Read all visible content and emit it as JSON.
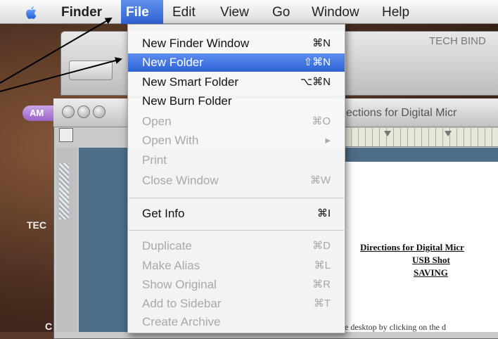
{
  "menubar": {
    "apple_icon": "apple-logo-icon",
    "items": [
      {
        "label": "Finder"
      },
      {
        "label": "File"
      },
      {
        "label": "Edit"
      },
      {
        "label": "View"
      },
      {
        "label": "Go"
      },
      {
        "label": "Window"
      },
      {
        "label": "Help"
      }
    ]
  },
  "file_menu": {
    "items": [
      {
        "label": "New Finder Window",
        "shortcut": "⌘N"
      },
      {
        "label": "New Folder",
        "shortcut": "⇧⌘N"
      },
      {
        "label": "New Smart Folder",
        "shortcut": "⌥⌘N"
      },
      {
        "label": "New Burn Folder",
        "shortcut": ""
      },
      {
        "label": "Open",
        "shortcut": "⌘O"
      },
      {
        "label": "Open With",
        "shortcut": "▸"
      },
      {
        "label": "Print",
        "shortcut": ""
      },
      {
        "label": "Close Window",
        "shortcut": "⌘W"
      },
      {
        "label": "Get Info",
        "shortcut": "⌘I"
      },
      {
        "label": "Duplicate",
        "shortcut": "⌘D"
      },
      {
        "label": "Make Alias",
        "shortcut": "⌘L"
      },
      {
        "label": "Show Original",
        "shortcut": "⌘R"
      },
      {
        "label": "Add to Sidebar",
        "shortcut": "⌘T"
      },
      {
        "label": "Create Archive",
        "shortcut": ""
      }
    ]
  },
  "background": {
    "finder_window_title": "TECH BIND",
    "am_badge": "AM",
    "doc_window_title": "ections for Digital Micr",
    "doc_heading_1": "Directions for Digital Micr",
    "doc_heading_2": "USB Shot",
    "doc_heading_3": "SAVING",
    "doc_body_fragment": "e desktop by clicking on the d",
    "desktop_label_tech": "TEC",
    "desktop_label_c": "C"
  },
  "colors": {
    "menu_highlight": "#3a6ddc",
    "arrow": "#000000"
  }
}
